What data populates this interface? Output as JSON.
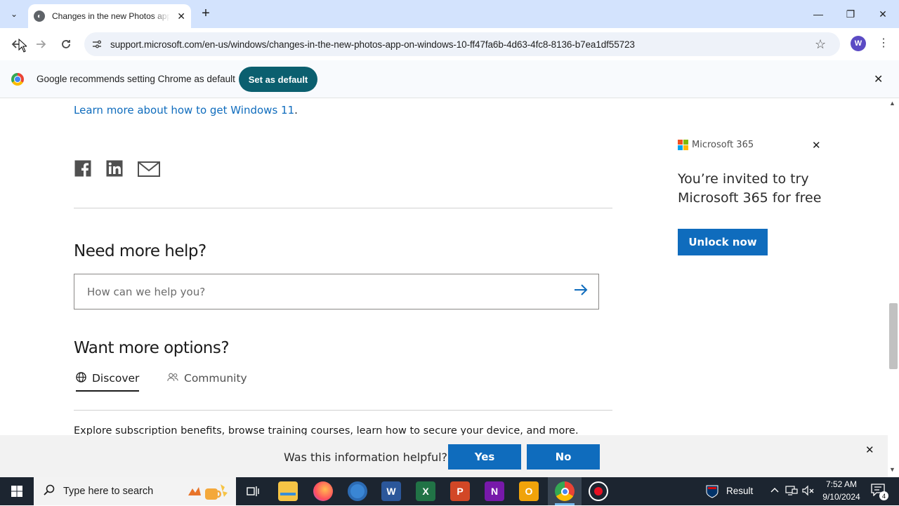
{
  "browser": {
    "tab_title": "Changes in the new Photos app",
    "url": "support.microsoft.com/en-us/windows/changes-in-the-new-photos-app-on-windows-10-ff47fa6b-4d63-4fc8-8136-b7ea1df55723",
    "profile_initial": "W",
    "icons": [
      "tab-search-icon",
      "close-icon",
      "new-tab-icon",
      "minimize-icon",
      "maximize-icon",
      "back-icon",
      "forward-icon",
      "reload-icon",
      "site-info-icon",
      "star-icon",
      "menu-icon"
    ]
  },
  "infobar": {
    "message": "Google recommends setting Chrome as default",
    "button_label": "Set as default"
  },
  "page": {
    "learn_more_link": "Learn more about how to get Windows 11",
    "learn_more_period": ".",
    "share_icons": [
      "facebook-icon",
      "linkedin-icon",
      "email-icon"
    ],
    "need_help_heading": "Need more help?",
    "search_placeholder": "How can we help you?",
    "want_more_heading": "Want more options?",
    "tabs": [
      {
        "label": "Discover",
        "icon": "globe-icon",
        "selected": true
      },
      {
        "label": "Community",
        "icon": "people-icon",
        "selected": false
      }
    ],
    "explore_text": "Explore subscription benefits, browse training courses, learn how to secure your device, and more."
  },
  "ad": {
    "brand": "Microsoft 365",
    "headline": "You’re invited to try Microsoft 365 for free",
    "button_label": "Unlock now",
    "logo_colors": [
      "#f25022",
      "#7fba00",
      "#00a4ef",
      "#ffb900"
    ]
  },
  "feedback": {
    "question": "Was this information helpful?",
    "yes_label": "Yes",
    "no_label": "No"
  },
  "taskbar": {
    "search_placeholder": "Type here to search",
    "apps": [
      "task-view-icon",
      "file-explorer-icon",
      "firefox-icon",
      "chromium-icon",
      "word-icon",
      "excel-icon",
      "powerpoint-icon",
      "onenote-icon",
      "outlook-icon",
      "chrome-icon",
      "screen-recorder-icon"
    ],
    "tray_result_label": "Result",
    "time": "7:52 AM",
    "date": "9/10/2024",
    "notification_count": "4"
  },
  "colors": {
    "accent": "#0f6cbd",
    "chrome_teal": "#0b5f6f",
    "titlebar": "#d3e3fd",
    "taskbar": "#1c2530"
  }
}
